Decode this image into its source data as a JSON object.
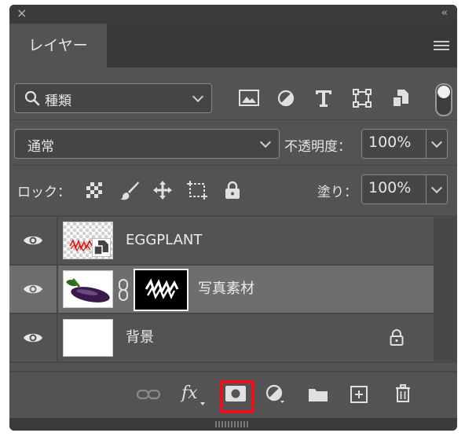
{
  "panel": {
    "close_glyph": "×",
    "collapse_glyph": "‹‹",
    "tab_label": "レイヤー",
    "menu_icon": "hamburger-menu-icon"
  },
  "filter": {
    "kind_label": "種類",
    "filter_icons": [
      "image-filter-icon",
      "adjustment-filter-icon",
      "type-filter-icon",
      "shape-filter-icon",
      "smart-object-filter-icon"
    ]
  },
  "blend": {
    "mode": "通常",
    "opacity_label": "不透明度：",
    "opacity_value": "100%"
  },
  "lock": {
    "label": "ロック：",
    "fill_label": "塗り：",
    "fill_value": "100%"
  },
  "layers": [
    {
      "name": "EGGPLANT",
      "visible": true,
      "type": "smart-object"
    },
    {
      "name": "写真素材",
      "visible": true,
      "type": "masked-photo",
      "selected": true
    },
    {
      "name": "背景",
      "visible": true,
      "type": "background",
      "locked": true
    }
  ],
  "footer": {
    "icons": [
      "link-layers-icon",
      "fx-icon",
      "add-mask-icon",
      "adjustment-layer-icon",
      "new-group-icon",
      "new-layer-icon",
      "delete-icon"
    ],
    "fx_label": "fx",
    "highlighted": "add-mask-icon",
    "highlight_color": "#e8101c"
  }
}
